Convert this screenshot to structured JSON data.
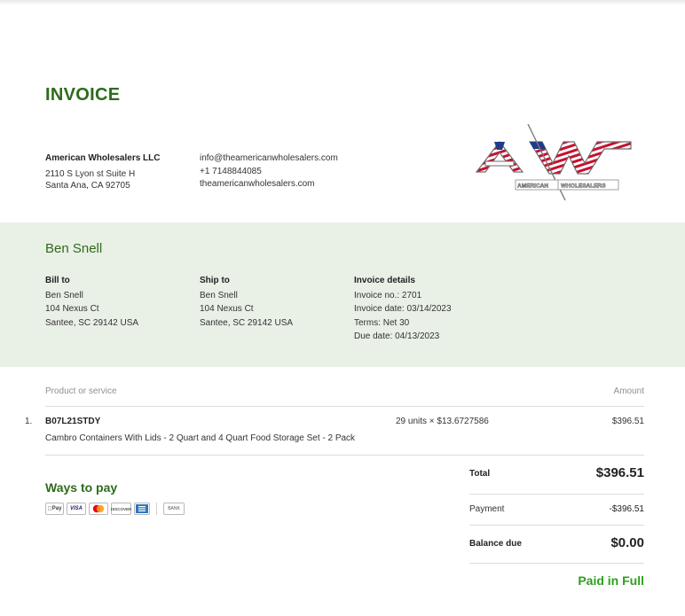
{
  "invoice": {
    "title": "INVOICE"
  },
  "company": {
    "name": "American Wholesalers LLC",
    "address_line1": "2110 S Lyon st Suite H",
    "address_line2": "Santa Ana, CA 92705",
    "email": "info@theamericanwholesalers.com",
    "phone": "+1 7148844085",
    "website": "theamericanwholesalers.com",
    "logo_letters": "AW",
    "logo_caption_left": "AMERICAN",
    "logo_caption_right": "WHOLESALERS"
  },
  "customer": {
    "name": "Ben Snell"
  },
  "bill_to": {
    "heading": "Bill to",
    "name": "Ben Snell",
    "line1": "104 Nexus Ct",
    "line2": "Santee, SC 29142 USA"
  },
  "ship_to": {
    "heading": "Ship to",
    "name": "Ben Snell",
    "line1": "104 Nexus Ct",
    "line2": "Santee, SC 29142 USA"
  },
  "details": {
    "heading": "Invoice details",
    "invoice_no": "Invoice no.: 2701",
    "invoice_date": "Invoice date: 03/14/2023",
    "terms": "Terms: Net 30",
    "due_date": "Due date: 04/13/2023"
  },
  "table": {
    "col_product": "Product or service",
    "col_amount": "Amount",
    "rows": [
      {
        "num": "1.",
        "sku": "B07L21STDY",
        "description": "Cambro Containers With Lids - 2 Quart and 4 Quart Food Storage Set - 2 Pack",
        "qty": "29 units × $13.6727586",
        "amount": "$396.51"
      }
    ]
  },
  "payment_methods": {
    "title": "Ways to pay",
    "cards": [
      "Pay",
      "VISA",
      "DISCOVER",
      "BANK"
    ]
  },
  "summary": {
    "total_label": "Total",
    "total": "$396.51",
    "payment_label": "Payment",
    "payment": "-$396.51",
    "balance_label": "Balance due",
    "balance": "$0.00",
    "status": "Paid in Full"
  },
  "colors": {
    "accent_green": "#2e6b1c",
    "paid_green": "#2ca01c",
    "band": "#e9f0e6"
  }
}
